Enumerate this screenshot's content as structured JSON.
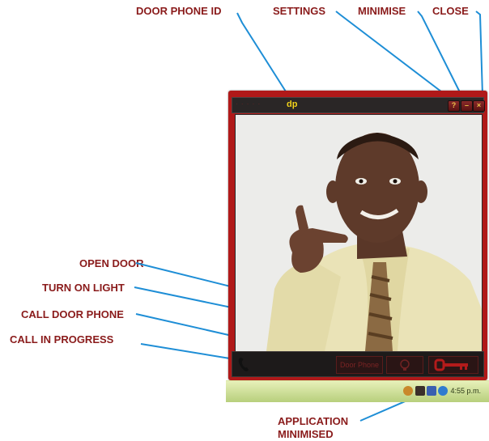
{
  "callouts": {
    "door_phone_id": "DOOR PHONE ID",
    "settings": "SETTINGS",
    "minimise": "MINIMISE",
    "close": "CLOSE",
    "open_door": "OPEN DOOR",
    "turn_on_light": "TURN ON LIGHT",
    "call_door_phone": "CALL DOOR PHONE",
    "call_in_progress": "CALL IN PROGRESS",
    "application_minimised_line1": "APPLICATION",
    "application_minimised_line2": "MINIMISED"
  },
  "app": {
    "door_phone_id": "dp",
    "door_phone_button": "Door Phone"
  },
  "taskbar": {
    "clock": "4:55 p.m."
  },
  "colors": {
    "callout_text": "#8a1b1b",
    "callout_line": "#1e8ed6",
    "window_frame": "#b01919",
    "id_text": "#f1d11a"
  },
  "icons": {
    "settings": "settings-icon",
    "minimise": "minimise-icon",
    "close": "close-icon",
    "call": "phone-handset-icon",
    "light": "light-bulb-icon",
    "open_door": "key-icon"
  }
}
